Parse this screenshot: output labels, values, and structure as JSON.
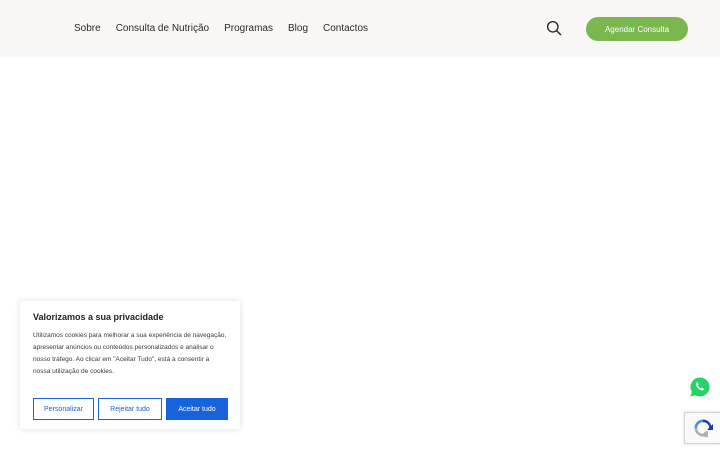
{
  "header": {
    "nav": [
      "Sobre",
      "Consulta de Nutrição",
      "Programas",
      "Blog",
      "Contactos"
    ],
    "cta_label": "Agendar Consulta",
    "search_icon": "search-icon",
    "colors": {
      "background": "#f8f7f5",
      "cta": "#7ab84f"
    }
  },
  "cookie_banner": {
    "title": "Valorizamos a sua privacidade",
    "text": "Utilizamos cookies para melhorar a sua experiência de navegação, apresentar anúncios ou conteúdos personalizados e analisar o nosso tráfego. Ao clicar em \"Aceitar Tudo\", está a consentir a nossa utilização de cookies.",
    "buttons": {
      "customize": "Personalizar",
      "reject": "Rejeitar tudo",
      "accept": "Aceitar tudo"
    },
    "colors": {
      "accent": "#1863dc"
    }
  },
  "floating": {
    "whatsapp_icon": "whatsapp-icon",
    "recaptcha_icon": "recaptcha-icon"
  }
}
